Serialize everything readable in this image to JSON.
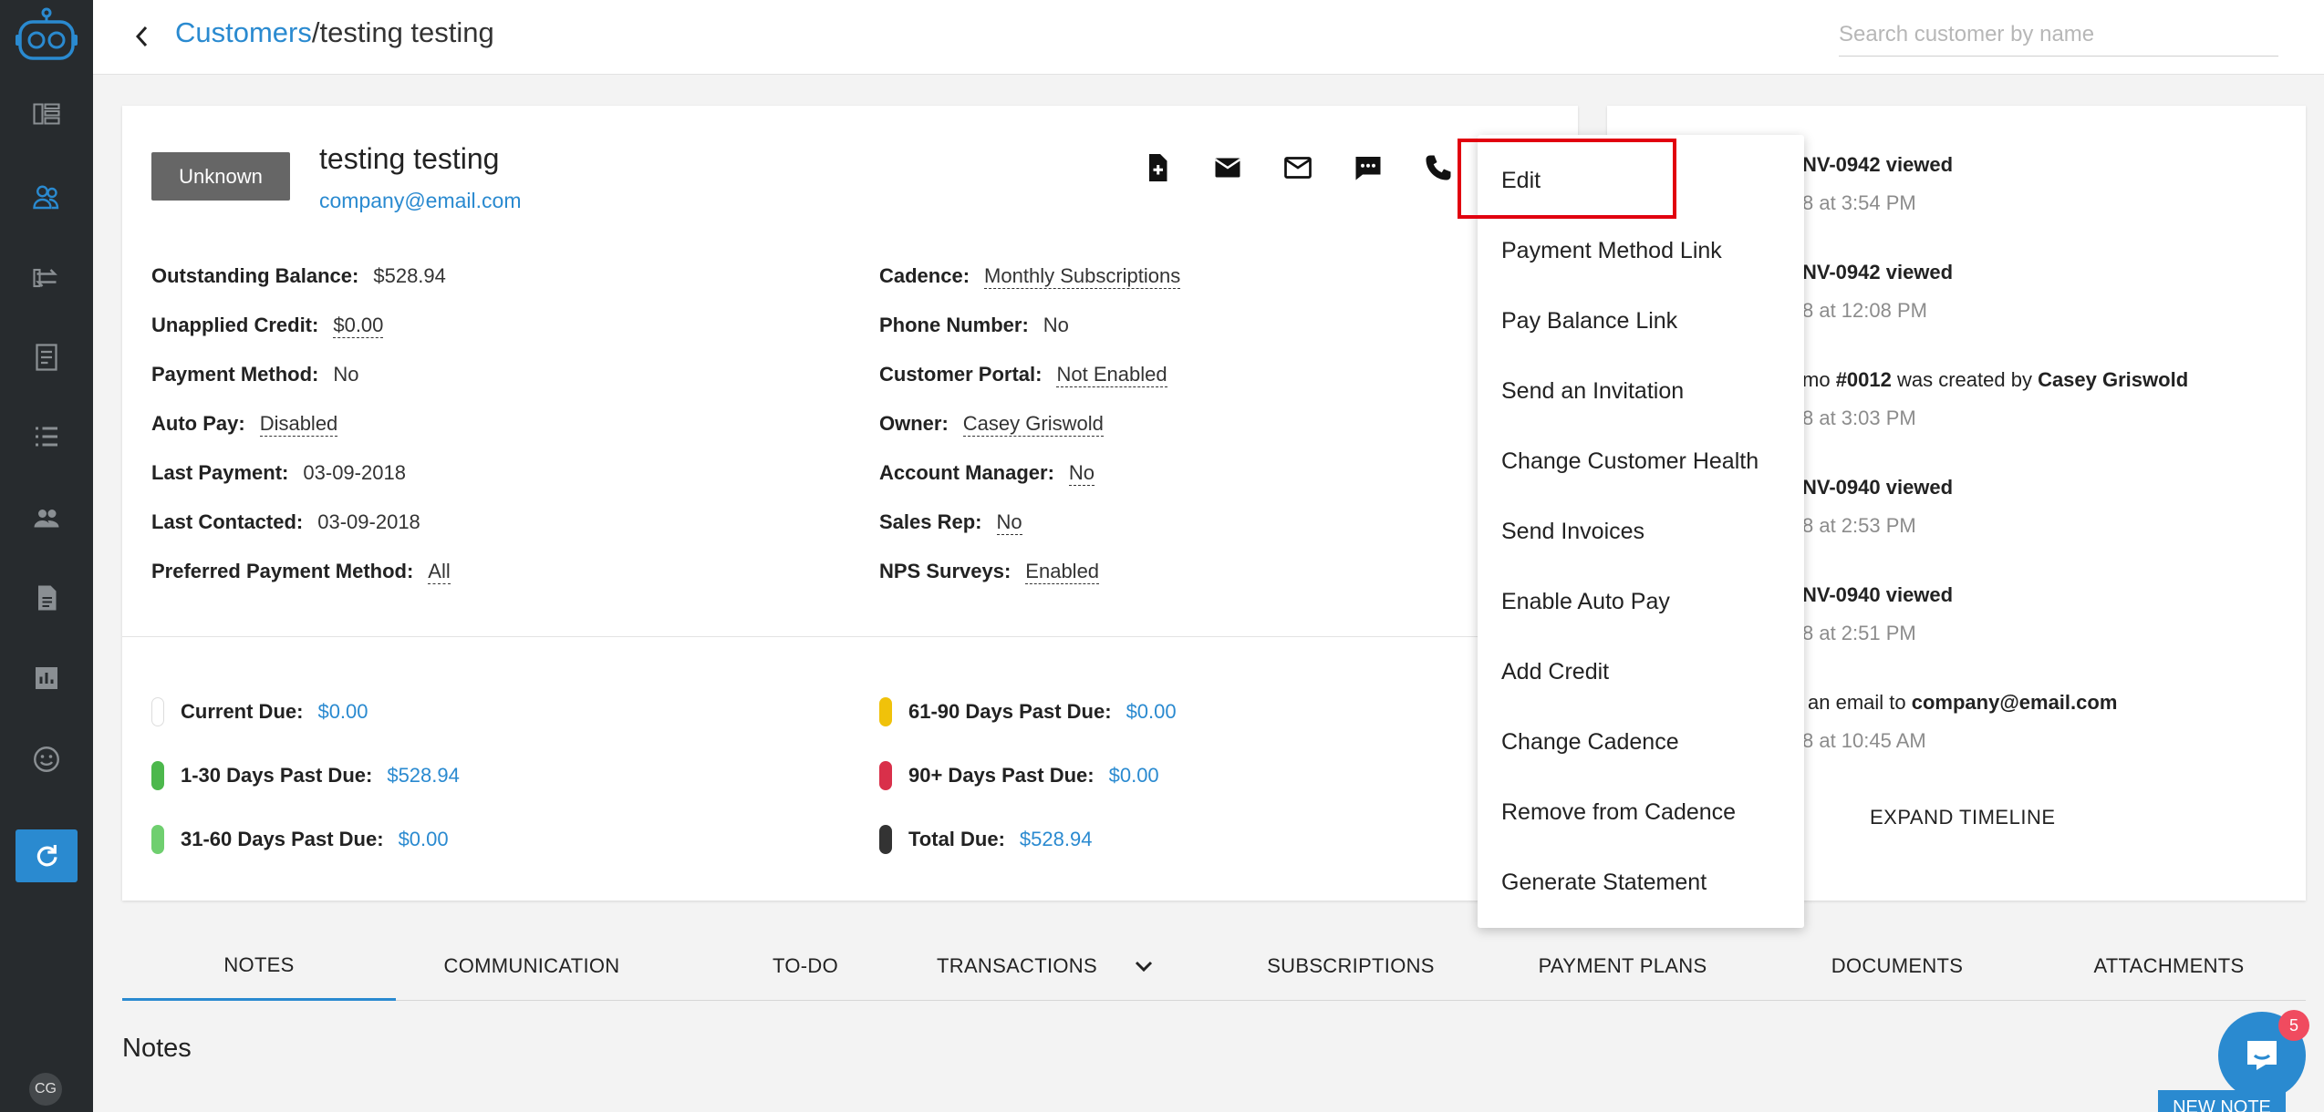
{
  "sidebar": {
    "user_initials": "CG",
    "active_item": "customers"
  },
  "topbar": {
    "breadcrumb_link": "Customers",
    "breadcrumb_current": "/testing testing",
    "search_placeholder": "Search customer by name"
  },
  "customer": {
    "status": "Unknown",
    "name": "testing testing",
    "email": "company@email.com"
  },
  "details_left": [
    {
      "label": "Outstanding Balance:",
      "value": "$528.94",
      "dotted": false
    },
    {
      "label": "Unapplied Credit:",
      "value": "$0.00",
      "dotted": true
    },
    {
      "label": "Payment Method:",
      "value": "No",
      "dotted": false
    },
    {
      "label": "Auto Pay:",
      "value": "Disabled",
      "dotted": true
    },
    {
      "label": "Last Payment:",
      "value": "03-09-2018",
      "dotted": false
    },
    {
      "label": "Last Contacted:",
      "value": "03-09-2018",
      "dotted": false
    },
    {
      "label": "Preferred Payment Method:",
      "value": "All",
      "dotted": true
    }
  ],
  "details_right": [
    {
      "label": "Cadence:",
      "value": "Monthly Subscriptions",
      "dotted": true
    },
    {
      "label": "Phone Number:",
      "value": "No",
      "dotted": false
    },
    {
      "label": "Customer Portal:",
      "value": "Not Enabled",
      "dotted": true
    },
    {
      "label": "Owner:",
      "value": "Casey Griswold",
      "dotted": true
    },
    {
      "label": "Account Manager:",
      "value": "No",
      "dotted": true
    },
    {
      "label": "Sales Rep:",
      "value": "No",
      "dotted": true
    },
    {
      "label": "NPS Surveys:",
      "value": "Enabled",
      "dotted": true
    }
  ],
  "aging_left": [
    {
      "label": "Current Due:",
      "amount": "$0.00",
      "color": "#ffffff"
    },
    {
      "label": "1-30 Days Past Due:",
      "amount": "$528.94",
      "color": "#4cb84c"
    },
    {
      "label": "31-60 Days Past Due:",
      "amount": "$0.00",
      "color": "#6fcf6f"
    }
  ],
  "aging_right": [
    {
      "label": "61-90 Days Past Due:",
      "amount": "$0.00",
      "color": "#f0c20a"
    },
    {
      "label": "90+ Days Past Due:",
      "amount": "$0.00",
      "color": "#d9304a"
    },
    {
      "label": "Total Due:",
      "amount": "$528.94",
      "color": "#333333"
    }
  ],
  "timeline": [
    {
      "text_html": "NV-0942 viewed",
      "date": "8 at 3:54 PM"
    },
    {
      "text_html": "NV-0942 viewed",
      "date": "8 at 12:08 PM"
    },
    {
      "text_html": "mo #0012 was created by Casey Griswold",
      "date": "8 at 3:03 PM"
    },
    {
      "text_html": "NV-0940 viewed",
      "date": "8 at 2:53 PM"
    },
    {
      "text_html": "NV-0940 viewed",
      "date": "8 at 2:51 PM"
    },
    {
      "text_html": " an email to company@email.com",
      "date": "8 at 10:45 AM"
    }
  ],
  "timeline_expand": "EXPAND TIMELINE",
  "menu": [
    "Edit",
    "Payment Method Link",
    "Pay Balance Link",
    "Send an Invitation",
    "Change Customer Health",
    "Send Invoices",
    "Enable Auto Pay",
    "Add Credit",
    "Change Cadence",
    "Remove from Cadence",
    "Generate Statement"
  ],
  "tabs": [
    "NOTES",
    "COMMUNICATION",
    "TO-DO",
    "TRANSACTIONS",
    "SUBSCRIPTIONS",
    "PAYMENT PLANS",
    "DOCUMENTS",
    "ATTACHMENTS"
  ],
  "active_tab": "NOTES",
  "notes_title": "Notes",
  "new_note_label": "NEW NOTE",
  "chat_badge": "5",
  "colors": {
    "accent": "#2a8ad0",
    "sidebar_bg": "#272b2e",
    "highlight": "#e1000f"
  }
}
